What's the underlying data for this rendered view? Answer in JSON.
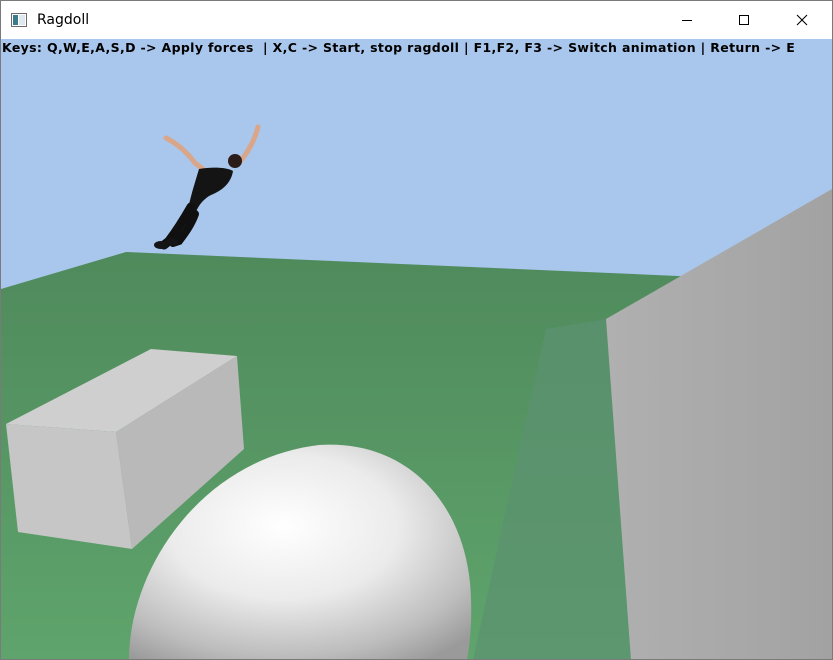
{
  "window": {
    "title": "Ragdoll",
    "icon": "app-window-icon",
    "controls": {
      "minimize_icon": "minimize-icon",
      "maximize_icon": "maximize-icon",
      "close_icon": "close-icon"
    }
  },
  "scene": {
    "hud_text": "Keys: Q,W,E,A,S,D -> Apply forces  | X,C -> Start, stop ragdoll | F1,F2, F3 -> Switch animation | Return -> E",
    "colors": {
      "sky": "#a9c6ec",
      "ground": "#5c9a68",
      "box": "#c8c8c8",
      "sphere": "#f0f0f0",
      "wall": "#a8a8a8"
    }
  }
}
